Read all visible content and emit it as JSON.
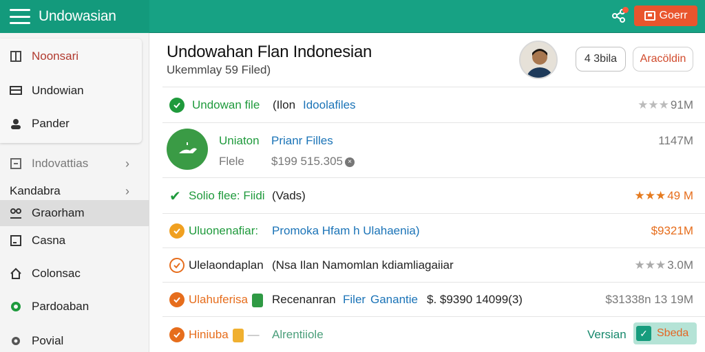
{
  "app": {
    "title": "Undowasian"
  },
  "topbar": {
    "button_label": "Goerr"
  },
  "sidebar": {
    "items": [
      {
        "label": "Noonsari",
        "icon": "grid-icon"
      },
      {
        "label": "Undowian",
        "icon": "monitor-icon"
      },
      {
        "label": "Pander",
        "icon": "user-icon"
      },
      {
        "label": "Indovattias",
        "icon": "edit-icon"
      },
      {
        "label": "Kandabra",
        "icon": ""
      },
      {
        "label": "Graorham",
        "icon": "people-icon"
      },
      {
        "label": "Casna",
        "icon": "window-icon"
      },
      {
        "label": "Colonsac",
        "icon": "home-icon"
      },
      {
        "label": "Pardoaban",
        "icon": "gear-green-icon"
      },
      {
        "label": "Povial",
        "icon": "gear-icon"
      }
    ]
  },
  "header": {
    "title": "Undowahan Flan Indonesian",
    "subtitle": "Ukemmlay 59 Filed)",
    "pill_1": "4 3bila",
    "pill_2": "Aracöldin"
  },
  "rows": [
    {
      "a": "Undowan file",
      "b": "(Ilon",
      "c": "Idoolafiles",
      "right": "91M",
      "stars": "★★★"
    },
    {
      "a": "Uniaton",
      "b": "Prianr Filles",
      "c": "Flele",
      "d": "$199 515.305",
      "right": "1147M"
    },
    {
      "a": "Solio flee: Fiidi",
      "b": "(Vads)",
      "right": "49 M",
      "stars": "★★★"
    },
    {
      "a": "Uluonenafiar:",
      "b": "Promoka Hfam h Ulahaenia)",
      "right": "$9321M"
    },
    {
      "a": "Ulelaondaplan",
      "b": "(Nsa Ilan Namomlan kdiamliagaiiar",
      "right": "3.0M",
      "stars": "★★★"
    },
    {
      "a": "Ulahuferisa",
      "b": "Recenanran",
      "c": "Filer",
      "d": "Ganantie",
      "e": "$. $9390 14099(3)",
      "right": "$31338n 13 19M"
    },
    {
      "a": "Hiniuba",
      "b": "Alrentiiole",
      "right": "Versian"
    }
  ],
  "footer": {
    "version_button": "Sbeda"
  },
  "colors": {
    "accent": "#17a284",
    "orange": "#e9552d",
    "green": "#1f9a3c",
    "blue": "#1a73b7"
  }
}
